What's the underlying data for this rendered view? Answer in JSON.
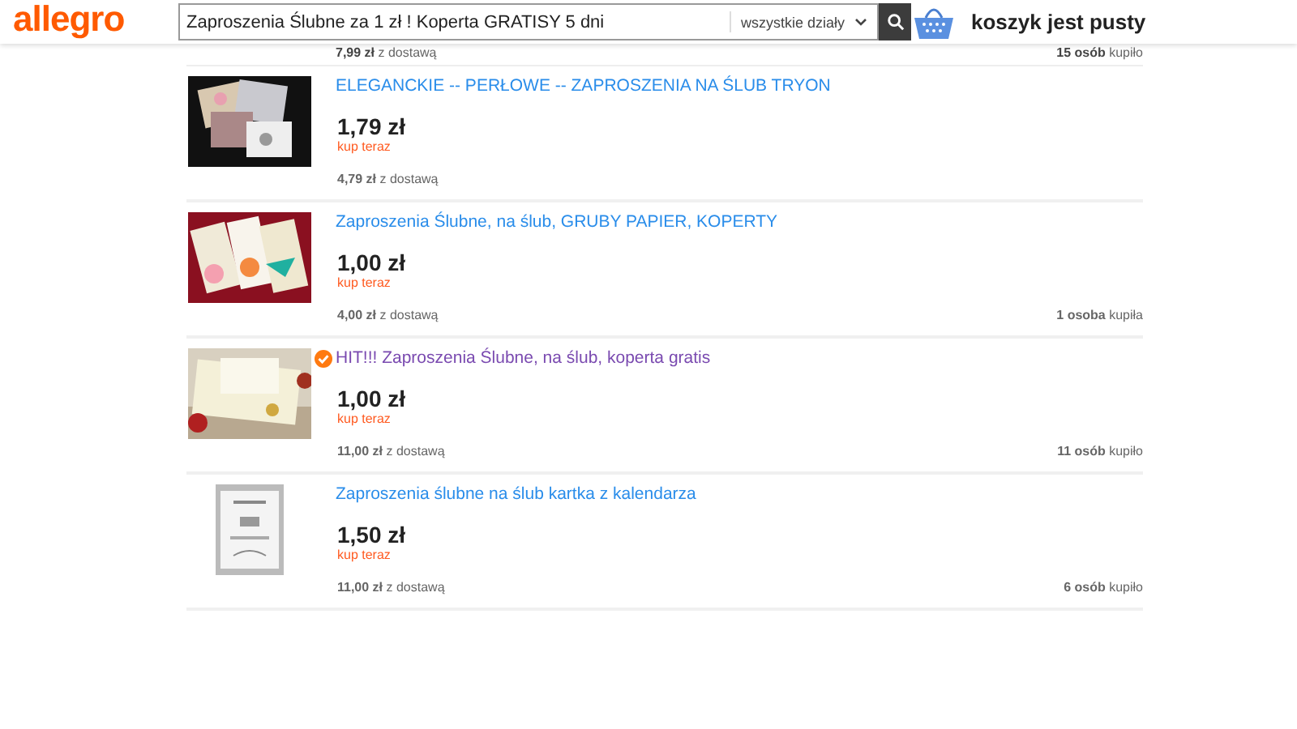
{
  "header": {
    "logo": "allegro",
    "search": {
      "value": "Zaproszenia Ślubne za 1 zł ! Koperta GRATISY 5 dni",
      "category": "wszystkie działy"
    },
    "cart": "koszyk jest pusty"
  },
  "previous_row": {
    "shipping": "**7,99 zł** z dostawą",
    "buyers": "**15 osób** kupiło"
  },
  "listings": [
    {
      "title": "ELEGANCKIE -- PERŁOWE -- ZAPROSZENIA NA ŚLUB TRYON",
      "visited": false,
      "badge": false,
      "price": "1,79 zł",
      "buy": "kup teraz",
      "shipping": "**4,79 zł** z dostawą"
    },
    {
      "title": "Zaproszenia Ślubne, na ślub, GRUBY PAPIER, KOPERTY",
      "visited": false,
      "badge": false,
      "price": "1,00 zł",
      "buy": "kup teraz",
      "shipping": "**4,00 zł** z dostawą",
      "buyers": "**1 osoba** kupiła"
    },
    {
      "title": "HIT!!! Zaproszenia Ślubne, na ślub, koperta gratis",
      "visited": true,
      "badge": true,
      "price": "1,00 zł",
      "buy": "kup teraz",
      "shipping": "**11,00 zł** z dostawą",
      "buyers": "**11 osób** kupiło"
    },
    {
      "title": "Zaproszenia ślubne na ślub kartka z kalendarza",
      "visited": false,
      "badge": false,
      "price": "1,50 zł",
      "buy": "kup teraz",
      "shipping": "**11,00 zł** z dostawą",
      "buyers": "**6 osób** kupiło"
    }
  ]
}
